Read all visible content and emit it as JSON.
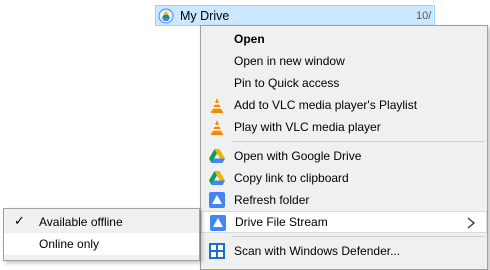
{
  "explorer": {
    "drive_name": "My Drive",
    "date_fragment": "10/"
  },
  "context_menu": {
    "items": [
      {
        "label": "Open",
        "icon": "none",
        "bold": true
      },
      {
        "label": "Open in new window",
        "icon": "none"
      },
      {
        "label": "Pin to Quick access",
        "icon": "none"
      },
      {
        "label": "Add to VLC media player's Playlist",
        "icon": "vlc-cone-icon"
      },
      {
        "label": "Play with VLC media player",
        "icon": "vlc-cone-icon"
      },
      {
        "label": "Open with Google Drive",
        "icon": "google-drive-icon"
      },
      {
        "label": "Copy link to clipboard",
        "icon": "google-drive-icon"
      },
      {
        "label": "Refresh folder",
        "icon": "drive-file-stream-icon"
      },
      {
        "label": "Drive File Stream",
        "icon": "drive-file-stream-icon",
        "has_submenu": true
      },
      {
        "label": "Scan with Windows Defender...",
        "icon": "windows-defender-icon"
      }
    ]
  },
  "submenu": {
    "items": [
      {
        "label": "Available offline",
        "checked": true
      },
      {
        "label": "Online only",
        "checked": false
      }
    ]
  },
  "colors": {
    "selection_bg": "#cce8ff",
    "menu_bg": "#f0f0f0",
    "vlc_orange": "#f48b00",
    "drive_blue": "#4285f4"
  }
}
